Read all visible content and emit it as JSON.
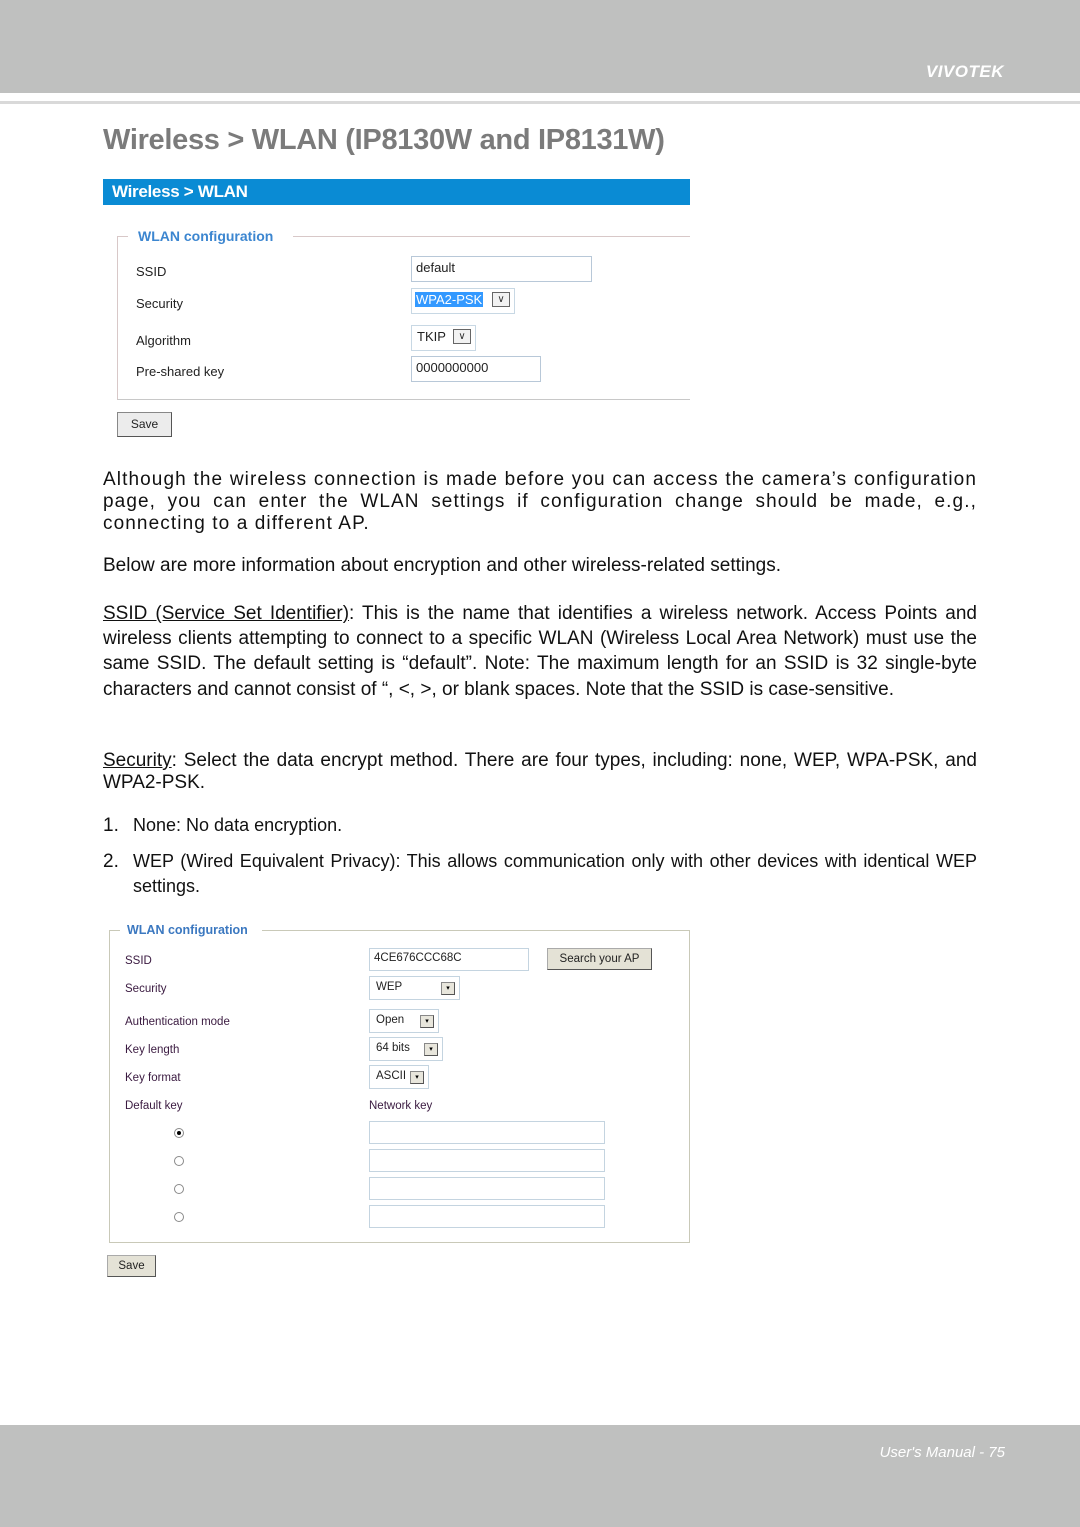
{
  "header": {
    "brand": "VIVOTEK"
  },
  "page_title": "Wireless > WLAN (IP8130W and IP8131W)",
  "screenshot1": {
    "bar_title": "Wireless  > WLAN",
    "legend": "WLAN configuration",
    "fields": [
      {
        "label": "SSID",
        "type": "text",
        "value": "default"
      },
      {
        "label": "Security",
        "type": "select",
        "value": "WPA2-PSK",
        "highlighted": true
      },
      {
        "label": "Algorithm",
        "type": "select",
        "value": "TKIP"
      },
      {
        "label": "Pre-shared key",
        "type": "text",
        "value": "0000000000"
      }
    ],
    "save_label": "Save",
    "arrow_glyph": "∨"
  },
  "body": {
    "para1": "Although the wireless connection is made before you can access the camera’s configuration page, you can enter the WLAN settings if configuration change should be made, e.g., connecting to a different AP.",
    "para2": "Below are more information about encryption and other wireless-related settings.",
    "ssid_term": "SSID (Service Set Identifier)",
    "ssid_text": ": This is the name that identifies a wireless network. Access Points and wireless clients attempting to connect to a specific WLAN (Wireless Local Area Network) must use the same SSID. The default setting is “default”. Note: The maximum length for an SSID is 32 single-byte characters and cannot consist of “, <, >, or blank spaces. Note that the SSID is case-sensitive.",
    "security_term": "Security",
    "security_text": ": Select the data encrypt method. There are four types, including: none, WEP, WPA-PSK, and WPA2-PSK.",
    "list": [
      {
        "num": "1.",
        "text": "None: No data encryption."
      },
      {
        "num": "2.",
        "text": "WEP (Wired Equivalent Privacy): This allows communication only with other devices with identical WEP settings."
      }
    ]
  },
  "screenshot2": {
    "legend": "WLAN configuration",
    "ssid_label": "SSID",
    "ssid_value": "4CE676CCC68C",
    "search_button": "Search your AP",
    "security_label": "Security",
    "security_value": "WEP",
    "auth_label": "Authentication mode",
    "auth_value": "Open",
    "keylen_label": "Key length",
    "keylen_value": "64 bits",
    "keyfmt_label": "Key format",
    "keyfmt_value": "ASCII",
    "default_key_label": "Default key",
    "network_key_label": "Network key",
    "keys": [
      {
        "selected": true,
        "value": ""
      },
      {
        "selected": false,
        "value": ""
      },
      {
        "selected": false,
        "value": ""
      },
      {
        "selected": false,
        "value": ""
      }
    ],
    "save_label": "Save",
    "arrow_glyph": "▾"
  },
  "footer": {
    "text": "User's Manual - 75"
  }
}
